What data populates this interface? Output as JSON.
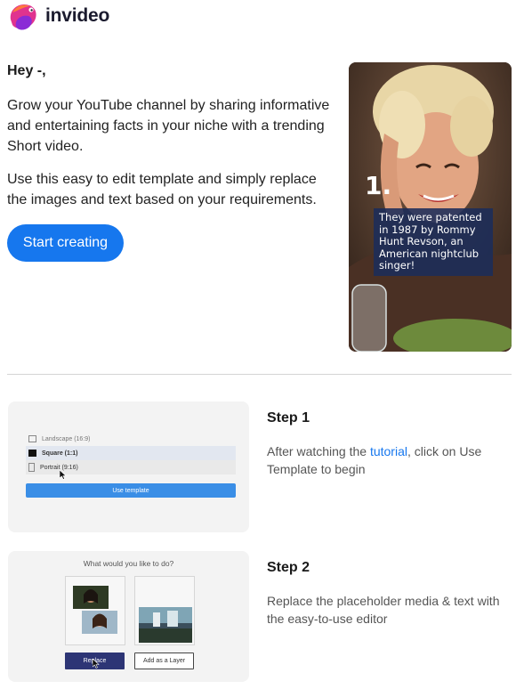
{
  "brand": {
    "name": "invideo",
    "logo_icon": "invideo-fish-logo-icon",
    "colors": {
      "primary": "#1677ee",
      "logo": "#e0338f"
    }
  },
  "intro": {
    "greeting": "Hey -,",
    "paragraph_1": "Grow your YouTube channel by sharing informative and entertaining facts in your niche with a trending Short video.",
    "paragraph_2": "Use this easy to edit template and simply replace the images and text based on your requirements.",
    "cta_label": "Start creating"
  },
  "hero": {
    "number": "1.",
    "caption": "They were patented in 1987 by Rommy Hunt Revson, an American nightclub singer!"
  },
  "steps": [
    {
      "title": "Step 1",
      "text_before": "After watching the ",
      "link_text": "tutorial",
      "text_after": ", click on Use Template to begin",
      "mock": {
        "options": [
          "Landscape (16:9)",
          "Square (1:1)",
          "Portrait (9:16)"
        ],
        "button": "Use template"
      }
    },
    {
      "title": "Step 2",
      "text": "Replace the placeholder media & text with the easy-to-use editor",
      "mock": {
        "question": "What would you like to do?",
        "button_replace": "Replace",
        "button_layer": "Add as a Layer"
      }
    }
  ]
}
